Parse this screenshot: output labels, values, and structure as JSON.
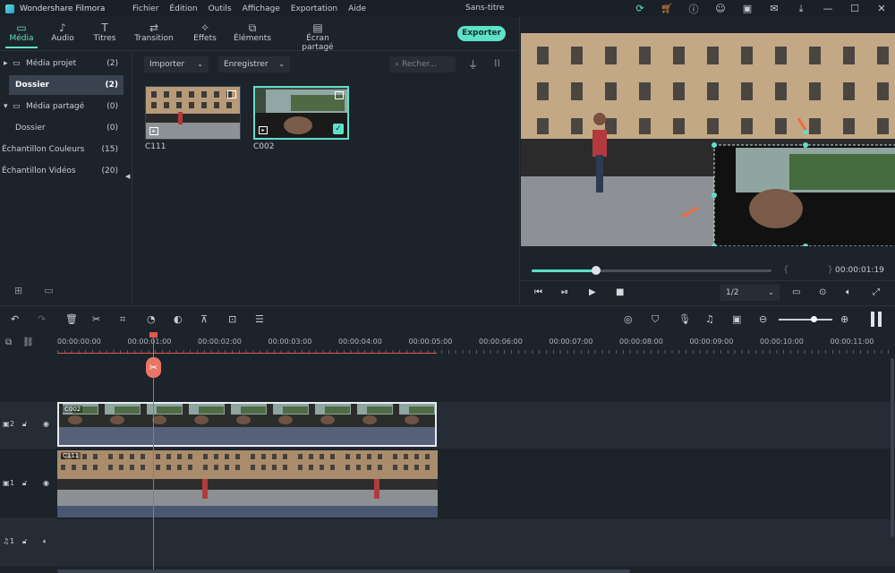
{
  "app": {
    "name": "Wondershare Filmora",
    "menu": [
      "Fichier",
      "Édition",
      "Outils",
      "Affichage",
      "Exportation",
      "Aide"
    ],
    "doc_title": "Sans-titre",
    "title_icons": [
      "refresh-icon",
      "cart-icon",
      "info-icon",
      "user-icon",
      "save-icon",
      "mail-icon",
      "download-icon",
      "minimize-icon",
      "maximize-icon",
      "close-icon"
    ]
  },
  "tabs": [
    {
      "label": "Média",
      "icon": "folder-icon",
      "active": true
    },
    {
      "label": "Audio",
      "icon": "music-icon",
      "active": false
    },
    {
      "label": "Titres",
      "icon": "text-icon",
      "active": false
    },
    {
      "label": "Transition",
      "icon": "transition-icon",
      "active": false
    },
    {
      "label": "Effets",
      "icon": "effects-icon",
      "active": false
    },
    {
      "label": "Éléments",
      "icon": "elements-icon",
      "active": false
    },
    {
      "label": "Écran partagé",
      "icon": "split-screen-icon",
      "active": false
    }
  ],
  "export_label": "Exporter",
  "folders": [
    {
      "label": "Média projet",
      "count": "(2)",
      "selected": false
    },
    {
      "label": "Dossier",
      "count": "(2)",
      "selected": true
    },
    {
      "label": "Média partagé",
      "count": "(0)",
      "selected": false
    },
    {
      "label": "Dossier",
      "count": "(0)",
      "selected": false
    },
    {
      "label": "Échantillon Couleurs",
      "count": "(15)",
      "selected": false
    },
    {
      "label": "Échantillon Vidéos",
      "count": "(20)",
      "selected": false
    }
  ],
  "library": {
    "import_label": "Importer",
    "record_label": "Enregistrer",
    "search_placeholder": "Recher...",
    "clips": [
      {
        "name": "C111",
        "selected": false
      },
      {
        "name": "C002",
        "selected": true
      }
    ]
  },
  "preview": {
    "progress": 0.27,
    "timecode": "00:00:01:19",
    "brackets": "{ }",
    "ratio": "1/2"
  },
  "ruler": {
    "labels": [
      "00:00:00:00",
      "00:00:01:00",
      "00:00:02:00",
      "00:00:03:00",
      "00:00:04:00",
      "00:00:05:00",
      "00:00:06:00",
      "00:00:07:00",
      "00:00:08:00",
      "00:00:09:00",
      "00:00:10:00",
      "00:00:11:00"
    ]
  },
  "timeline": {
    "tracks": [
      {
        "id": "2",
        "type": "video",
        "clip": "C002"
      },
      {
        "id": "1",
        "type": "video",
        "clip": "C111"
      },
      {
        "id": "1",
        "type": "audio",
        "clip": ""
      }
    ],
    "zoom": 0.65
  },
  "colors": {
    "accent": "#5fe0c8",
    "playhead": "#e05a4e",
    "background": "#1d232b"
  }
}
